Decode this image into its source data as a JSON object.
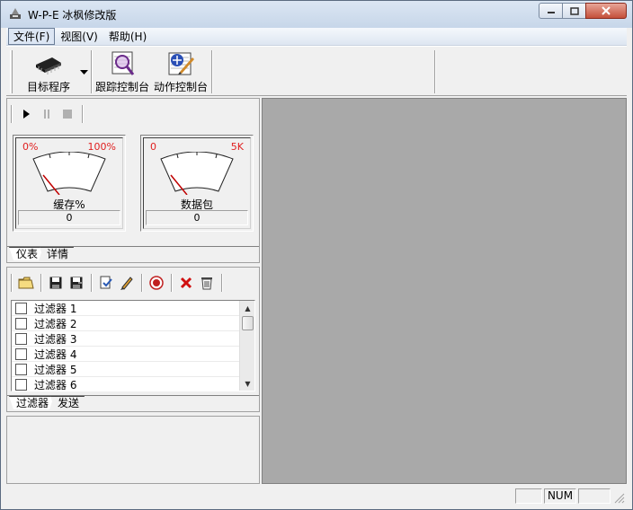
{
  "window": {
    "title": "W-P-E 冰枫修改版"
  },
  "menu": {
    "items": [
      {
        "label": "文件(F)"
      },
      {
        "label": "视图(V)"
      },
      {
        "label": "帮助(H)"
      }
    ]
  },
  "toolbar": {
    "target_label": "目标程序",
    "trace_label": "跟踪控制台",
    "action_label": "动作控制台"
  },
  "gauges": [
    {
      "min": "0%",
      "max": "100%",
      "label": "缓存%",
      "value": "0",
      "fraction": 0
    },
    {
      "min": "0",
      "max": "5K",
      "label": "数据包",
      "value": "0",
      "fraction": 0
    }
  ],
  "pane1_tabs": [
    {
      "label": "仪表"
    },
    {
      "label": "详情"
    }
  ],
  "filters": [
    {
      "label": "过滤器 1",
      "checked": false
    },
    {
      "label": "过滤器 2",
      "checked": false
    },
    {
      "label": "过滤器 3",
      "checked": false
    },
    {
      "label": "过滤器 4",
      "checked": false
    },
    {
      "label": "过滤器 5",
      "checked": false
    },
    {
      "label": "过滤器 6",
      "checked": false
    }
  ],
  "pane2_tabs": [
    {
      "label": "过滤器"
    },
    {
      "label": "发送"
    }
  ],
  "status": {
    "num": "NUM"
  },
  "colors": {
    "workspace": "#a9a9a9",
    "gauge_red": "#e02020"
  }
}
